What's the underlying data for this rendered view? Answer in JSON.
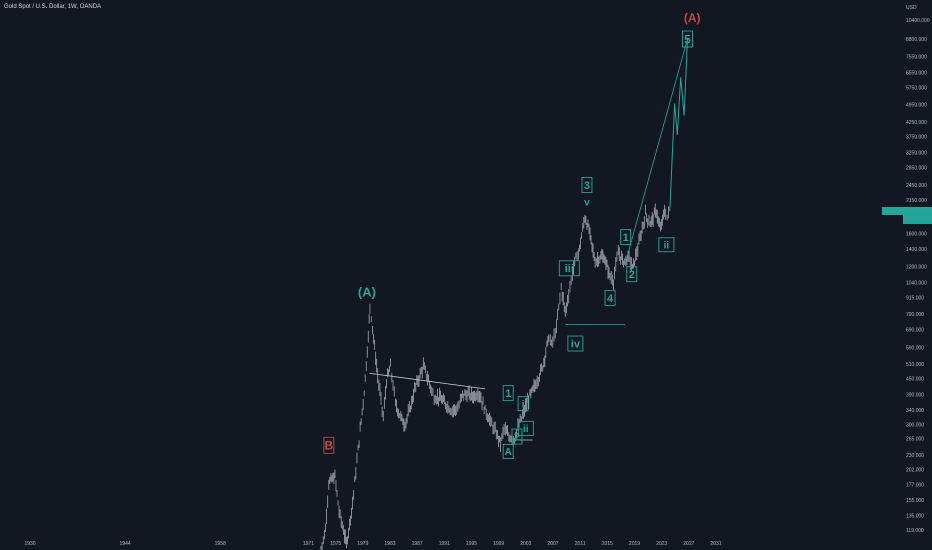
{
  "header": {
    "title": "Gold Spot / U.S. Dollar, 1W, OANDA",
    "currency": "USD"
  },
  "colors": {
    "background": "#131722",
    "candle": "#b9bcc4",
    "accent_teal": "#26a69a",
    "accent_red": "#c04848",
    "axis_text": "#b2b5be",
    "price_tag": "#26a69a"
  },
  "chart_data": {
    "type": "line",
    "y_scale": "log",
    "ylim": [
      110,
      10400
    ],
    "xlim": [
      1930,
      2034
    ],
    "y_ticks": [
      "10400.000",
      "8800.000",
      "7550.000",
      "6550.000",
      "5750.000",
      "4950.000",
      "4250.000",
      "3750.000",
      "3250.000",
      "2850.000",
      "2450.000",
      "2150.000",
      "1850.000",
      "1600.000",
      "1400.000",
      "1200.000",
      "1040.000",
      "915.000",
      "790.000",
      "690.000",
      "590.000",
      "510.000",
      "450.000",
      "390.000",
      "340.000",
      "300.000",
      "265.000",
      "230.000",
      "202.000",
      "177.000",
      "155.000",
      "135.000",
      "119.000"
    ],
    "x_ticks": [
      "1930",
      "1944",
      "1958",
      "1971",
      "1975",
      "1979",
      "1983",
      "1987",
      "1991",
      "1995",
      "1999",
      "2003",
      "2007",
      "2011",
      "2015",
      "2019",
      "2023",
      "2027",
      "2031"
    ],
    "series": [
      {
        "x": [
          1972.5,
          1973.5,
          1974.0,
          1974.9,
          1975.5,
          1976.6,
          1977.5,
          1978.3,
          1979.2,
          1979.8,
          1980.05,
          1980.6,
          1981.2,
          1982.0,
          1982.5,
          1983.1,
          1983.8,
          1984.6,
          1985.2,
          1986.0,
          1986.8,
          1987.9,
          1988.8,
          1989.5,
          1990.3,
          1991.2,
          1992.0,
          1993.0,
          1993.7,
          1994.5,
          1995.3,
          1996.1,
          1997.0,
          1998.0,
          1999.3,
          1999.8,
          2000.5,
          2001.3,
          2002.0,
          2002.8,
          2003.6,
          2004.5,
          2005.5,
          2006.4,
          2006.8,
          2007.5,
          2008.2,
          2008.8,
          2009.5,
          2010.2,
          2010.9,
          2011.7,
          2012.3,
          2013.2,
          2013.9,
          2014.5,
          2015.4,
          2015.9,
          2016.6,
          2017.4,
          2018.2,
          2018.7,
          2019.5,
          2020.6,
          2021.3,
          2022.2,
          2022.8,
          2023.4,
          2023.8,
          2024.2
        ],
        "values": [
          90,
          120,
          180,
          190,
          140,
          105,
          150,
          240,
          400,
          650,
          850,
          640,
          460,
          320,
          440,
          500,
          360,
          320,
          300,
          350,
          420,
          500,
          430,
          380,
          380,
          360,
          340,
          345,
          390,
          390,
          385,
          395,
          340,
          300,
          255,
          290,
          270,
          265,
          300,
          340,
          385,
          430,
          500,
          650,
          600,
          700,
          1000,
          800,
          1000,
          1250,
          1400,
          1850,
          1650,
          1250,
          1300,
          1300,
          1100,
          1060,
          1350,
          1250,
          1300,
          1180,
          1400,
          1900,
          1750,
          1950,
          1650,
          1950,
          1850,
          1950
        ]
      }
    ],
    "projection": {
      "x": [
        2024.2,
        2024.9,
        2025.3,
        2025.8,
        2026.3,
        2026.8
      ],
      "values": [
        1950,
        5000,
        3800,
        6300,
        4500,
        8800
      ]
    },
    "levels": [
      {
        "name": "",
        "x": [
          1980.0,
          1997.0
        ],
        "values": [
          470,
          410
        ]
      },
      {
        "name": "",
        "x": [
          2008.8,
          2017.6
        ],
        "values": [
          720,
          720
        ]
      },
      {
        "name": "",
        "x": [
          2001.3,
          2004.0
        ],
        "values": [
          262,
          262
        ]
      }
    ],
    "wave_labels": [
      {
        "text": "(A)",
        "x": 1979.6,
        "value": 960,
        "color": "teal",
        "boxed": false,
        "size": 13
      },
      {
        "text": "(A)",
        "x": 2027.5,
        "value": 10600,
        "color": "red",
        "boxed": false,
        "size": 12
      },
      {
        "text": "B",
        "x": 1974.0,
        "value": 250,
        "color": "red",
        "boxed": true,
        "size": 12
      },
      {
        "text": "A",
        "x": 2000.4,
        "value": 237,
        "color": "teal",
        "boxed": true,
        "size": 10
      },
      {
        "text": "1",
        "x": 2000.4,
        "value": 395,
        "color": "teal",
        "boxed": true,
        "size": 11
      },
      {
        "text": "2",
        "x": 2001.7,
        "value": 270,
        "color": "teal",
        "boxed": true,
        "size": 11
      },
      {
        "text": "ii",
        "x": 2003.0,
        "value": 290,
        "color": "teal",
        "boxed": true,
        "size": 10
      },
      {
        "text": "i",
        "x": 2002.6,
        "value": 360,
        "color": "teal",
        "boxed": true,
        "size": 10
      },
      {
        "text": "iii",
        "x": 2009.4,
        "value": 1180,
        "color": "teal",
        "boxed": true,
        "size": 11
      },
      {
        "text": "iv",
        "x": 2010.3,
        "value": 610,
        "color": "teal",
        "boxed": true,
        "size": 11
      },
      {
        "text": "3",
        "x": 2012.0,
        "value": 2450,
        "color": "teal",
        "boxed": true,
        "size": 11
      },
      {
        "text": "v",
        "x": 2012.0,
        "value": 2110,
        "color": "teal",
        "boxed": false,
        "size": 10
      },
      {
        "text": "1",
        "x": 2017.7,
        "value": 1550,
        "color": "teal",
        "boxed": true,
        "size": 11
      },
      {
        "text": "4",
        "x": 2015.4,
        "value": 910,
        "color": "teal",
        "boxed": true,
        "size": 11
      },
      {
        "text": "2",
        "x": 2018.6,
        "value": 1120,
        "color": "teal",
        "boxed": true,
        "size": 11
      },
      {
        "text": "ii",
        "x": 2023.7,
        "value": 1450,
        "color": "teal",
        "boxed": true,
        "size": 10
      },
      {
        "text": "5",
        "x": 2026.8,
        "value": 8800,
        "color": "teal",
        "boxed": true,
        "size": 12
      }
    ],
    "current_price_value": 1950
  }
}
